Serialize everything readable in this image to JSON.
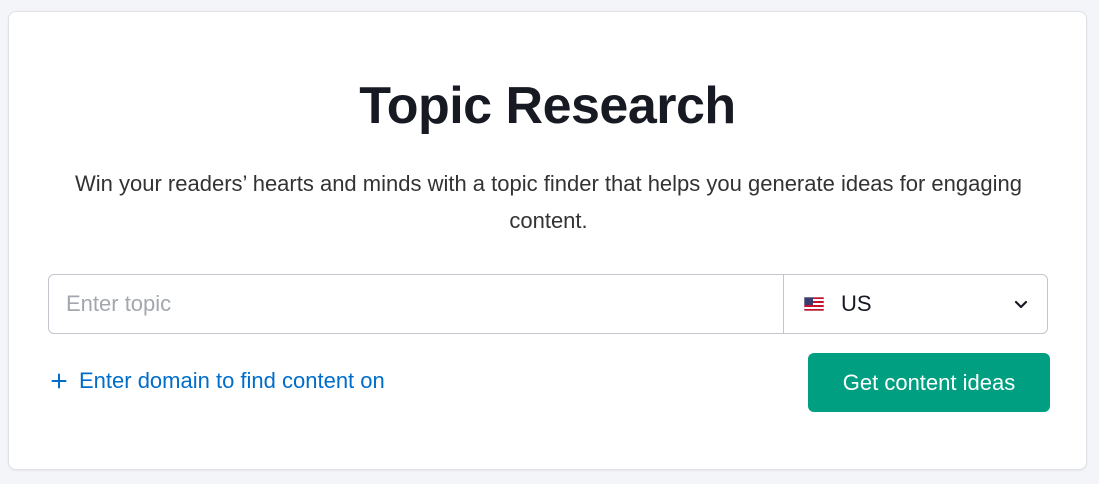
{
  "header": {
    "title": "Topic Research",
    "subtitle": "Win your readers’ hearts and minds with a topic finder that helps you generate ideas for engaging content."
  },
  "search": {
    "topic_placeholder": "Enter topic",
    "topic_value": "",
    "country": {
      "selected": "US",
      "flag_icon": "us-flag-icon",
      "dropdown_icon": "chevron-down-icon"
    }
  },
  "actions": {
    "add_domain_label": "Enter domain to find content on",
    "add_domain_icon": "plus-icon",
    "submit_label": "Get content ideas"
  },
  "colors": {
    "accent_green": "#009f81",
    "link_blue": "#006dca",
    "title": "#171a22",
    "border": "#c3c6cc"
  }
}
